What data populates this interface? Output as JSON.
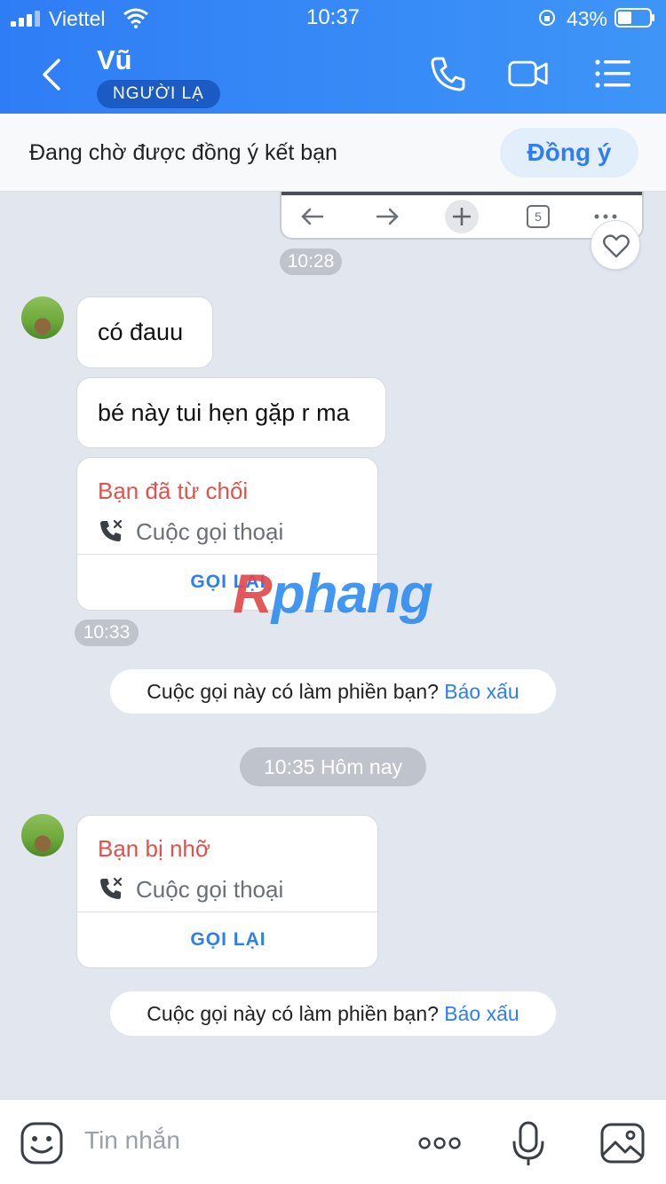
{
  "status_bar": {
    "carrier": "Viettel",
    "time": "10:37",
    "battery": "43%"
  },
  "header": {
    "name": "Vũ",
    "badge": "NGƯỜI LẠ"
  },
  "friend_bar": {
    "text": "Đang chờ được đồng ý kết bạn",
    "button": "Đồng ý"
  },
  "prev_card": {
    "tab_count": "5"
  },
  "messages": {
    "time1": "10:28",
    "msg1": "có đauu",
    "msg2": "bé này tui hẹn gặp r ma",
    "call1": {
      "title": "Bạn đã từ chối",
      "subtitle": "Cuộc gọi thoại",
      "action": "GỌI LẠI"
    },
    "time2": "10:33",
    "report1": {
      "text": "Cuộc gọi này có làm phiền bạn?",
      "link": "Báo xấu"
    },
    "divider": "10:35 Hôm nay",
    "call2": {
      "title": "Bạn bị nhỡ",
      "subtitle": "Cuộc gọi thoại",
      "action": "GỌI LẠI"
    },
    "report2": {
      "text": "Cuộc gọi này có làm phiền bạn?",
      "link": "Báo xấu"
    }
  },
  "watermark": {
    "first": "R",
    "rest": "phang"
  },
  "composer": {
    "placeholder": "Tin nhắn"
  }
}
